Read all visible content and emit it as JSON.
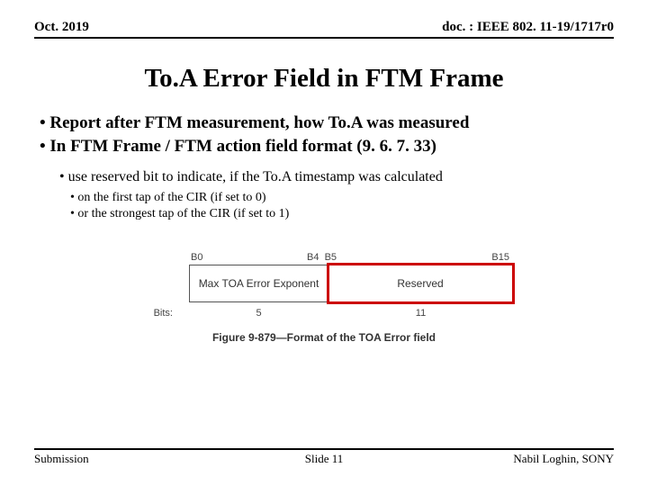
{
  "header": {
    "left": "Oct. 2019",
    "right": "doc. : IEEE 802. 11-19/1717r0"
  },
  "title": "To.A Error Field in FTM Frame",
  "bullets1": [
    "Report after FTM measurement, how To.A was measured",
    "In FTM Frame / FTM action field format (9. 6. 7. 33)"
  ],
  "bullet2": "use reserved bit to indicate, if the To.A timestamp was calculated",
  "bullets3": [
    "on the first tap of the CIR (if set to 0)",
    "or the strongest tap of the CIR (if set to 1)"
  ],
  "figure": {
    "bitlabels": {
      "b0": "B0",
      "b4": "B4",
      "b5": "B5",
      "b15": "B15"
    },
    "field1": "Max TOA Error Exponent",
    "field2": "Reserved",
    "bits_label": "Bits:",
    "bits1": "5",
    "bits2": "11",
    "caption": "Figure 9-879—Format of the TOA Error field"
  },
  "footer": {
    "left": "Submission",
    "center": "Slide 11",
    "right": "Nabil Loghin, SONY"
  }
}
